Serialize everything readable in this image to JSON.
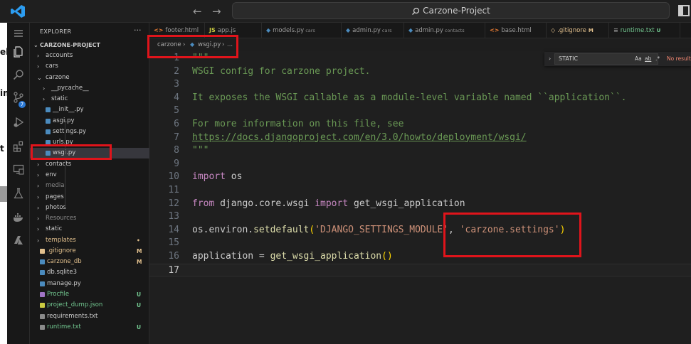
{
  "titlebar": {
    "search_text": "Carzone-Project",
    "back_icon": "arrow-left-icon",
    "forward_icon": "arrow-right-icon"
  },
  "left_strip": {
    "chars": [
      "el",
      "in",
      "t"
    ]
  },
  "activity_bar": {
    "items": [
      "menu-icon",
      "files-icon",
      "search-icon",
      "source-control-icon",
      "run-debug-icon",
      "extensions-icon",
      "remote-explorer-icon",
      "testing-icon",
      "docker-icon",
      "azure-icon"
    ],
    "source_control_badge": "7"
  },
  "sidebar": {
    "header": "EXPLORER",
    "more": "···",
    "root": "CARZONE-PROJECT",
    "items": [
      {
        "label": "accounts",
        "kind": "folder",
        "status": ""
      },
      {
        "label": "cars",
        "kind": "folder",
        "status": ""
      },
      {
        "label": "carzone",
        "kind": "folder-open",
        "status": ""
      },
      {
        "label": "__pycache__",
        "kind": "folder",
        "status": ""
      },
      {
        "label": "static",
        "kind": "folder",
        "status": ""
      },
      {
        "label": "__init__.py",
        "kind": "py",
        "status": ""
      },
      {
        "label": "asgi.py",
        "kind": "py",
        "status": ""
      },
      {
        "label": "settings.py",
        "kind": "py",
        "status": ""
      },
      {
        "label": "urls.py",
        "kind": "py",
        "status": ""
      },
      {
        "label": "wsgi.py",
        "kind": "py",
        "status": ""
      },
      {
        "label": "contacts",
        "kind": "folder",
        "status": ""
      },
      {
        "label": "env",
        "kind": "folder",
        "status": ""
      },
      {
        "label": "media",
        "kind": "folder-dim",
        "status": ""
      },
      {
        "label": "pages",
        "kind": "folder",
        "status": ""
      },
      {
        "label": "photos",
        "kind": "folder",
        "status": ""
      },
      {
        "label": "Resources",
        "kind": "folder-dim",
        "status": ""
      },
      {
        "label": "static",
        "kind": "folder",
        "status": ""
      },
      {
        "label": "templates",
        "kind": "folder-mod",
        "status": "•"
      },
      {
        "label": ".gitignore",
        "kind": "git-mod",
        "status": "M"
      },
      {
        "label": "carzone_db",
        "kind": "db-mod",
        "status": "M"
      },
      {
        "label": "db.sqlite3",
        "kind": "db",
        "status": ""
      },
      {
        "label": "manage.py",
        "kind": "py",
        "status": ""
      },
      {
        "label": "Procfile",
        "kind": "proc-new",
        "status": "U"
      },
      {
        "label": "project_dump.json",
        "kind": "json-new",
        "status": "U"
      },
      {
        "label": "requirements.txt",
        "kind": "txt",
        "status": ""
      },
      {
        "label": "runtime.txt",
        "kind": "txt-new",
        "status": "U"
      }
    ]
  },
  "tabs": [
    {
      "label": "footer.html",
      "desc": "",
      "status": "",
      "icon": "<>"
    },
    {
      "label": "app.js",
      "desc": "",
      "status": "",
      "icon": "JS"
    },
    {
      "label": "models.py",
      "desc": "cars",
      "status": "",
      "icon": "py"
    },
    {
      "label": "admin.py",
      "desc": "cars",
      "status": "",
      "icon": "py"
    },
    {
      "label": "admin.py",
      "desc": "contacts",
      "status": "",
      "icon": "py"
    },
    {
      "label": "base.html",
      "desc": "",
      "status": "",
      "icon": "<>"
    },
    {
      "label": ".gitignore",
      "desc": "",
      "status": "M",
      "icon": "git"
    },
    {
      "label": "runtime.txt",
      "desc": "",
      "status": "U",
      "icon": "txt"
    }
  ],
  "breadcrumb": {
    "folder": "carzone",
    "file": "wsgi.py",
    "tail": "..."
  },
  "find_widget": {
    "value": "STATIC",
    "match_case": "Aa",
    "whole_word": "ab",
    "regex": ".*",
    "result": "No results"
  },
  "editor": {
    "current_line": 17,
    "lines": [
      {
        "n": "1",
        "segments": [
          {
            "t": "\"\"\"",
            "c": "str"
          }
        ]
      },
      {
        "n": "2",
        "segments": [
          {
            "t": "WSGI config for carzone project.",
            "c": "str"
          }
        ]
      },
      {
        "n": "3",
        "segments": []
      },
      {
        "n": "4",
        "segments": [
          {
            "t": "It exposes the WSGI callable as a module-level variable named ``application``.",
            "c": "str"
          }
        ]
      },
      {
        "n": "5",
        "segments": []
      },
      {
        "n": "6",
        "segments": [
          {
            "t": "For more information on this file, see",
            "c": "str"
          }
        ]
      },
      {
        "n": "7",
        "segments": [
          {
            "t": "https://docs.djangoproject.com/en/3.0/howto/deployment/wsgi/",
            "c": "link"
          }
        ]
      },
      {
        "n": "8",
        "segments": [
          {
            "t": "\"\"\"",
            "c": "str"
          }
        ]
      },
      {
        "n": "9",
        "segments": []
      },
      {
        "n": "10",
        "segments": [
          {
            "t": "import",
            "c": "kw"
          },
          {
            "t": " os",
            "c": "id"
          }
        ]
      },
      {
        "n": "11",
        "segments": []
      },
      {
        "n": "12",
        "segments": [
          {
            "t": "from",
            "c": "kw"
          },
          {
            "t": " django.core.wsgi ",
            "c": "id"
          },
          {
            "t": "import",
            "c": "kw"
          },
          {
            "t": " get_wsgi_application",
            "c": "id"
          }
        ]
      },
      {
        "n": "13",
        "segments": []
      },
      {
        "n": "14",
        "segments": [
          {
            "t": "os.environ.",
            "c": "id"
          },
          {
            "t": "setdefault",
            "c": "fn"
          },
          {
            "t": "(",
            "c": "p1"
          },
          {
            "t": "'DJANGO_SETTINGS_MODULE'",
            "c": "s"
          },
          {
            "t": ", ",
            "c": "id"
          },
          {
            "t": "'carzone.settings'",
            "c": "s"
          },
          {
            "t": ")",
            "c": "p1"
          }
        ]
      },
      {
        "n": "15",
        "segments": []
      },
      {
        "n": "16",
        "segments": [
          {
            "t": "application = ",
            "c": "id"
          },
          {
            "t": "get_wsgi_application",
            "c": "fn"
          },
          {
            "t": "()",
            "c": "p1"
          }
        ]
      },
      {
        "n": "17",
        "segments": []
      }
    ]
  },
  "colors": {
    "highlight_box": "#e0141b",
    "py_icon": "#4b8bbe",
    "modified": "#e2c08d",
    "untracked": "#73c991",
    "accent": "#0078d4"
  }
}
